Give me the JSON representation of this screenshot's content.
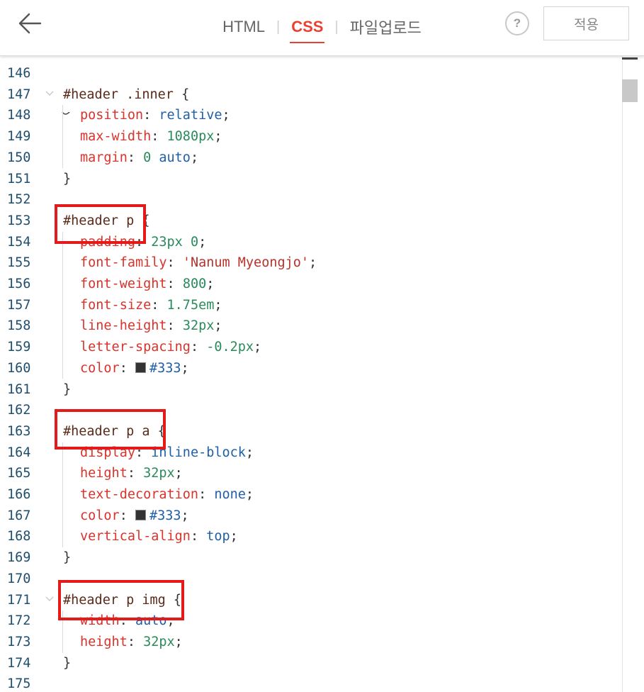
{
  "header": {
    "tabs": [
      {
        "label": "HTML",
        "active": false
      },
      {
        "label": "CSS",
        "active": true
      },
      {
        "label": "파일업로드",
        "active": false
      }
    ],
    "help_label": "?",
    "apply_label": "적용"
  },
  "colors": {
    "accent": "#e9402f",
    "highlight_box": "#e41a1a",
    "swatch_333": "#333333"
  },
  "editor": {
    "lines": [
      {
        "n": "146",
        "tokens": []
      },
      {
        "n": "147",
        "fold": true,
        "tokens": [
          {
            "t": "#header .inner",
            "c": "sel"
          },
          {
            "t": " {",
            "c": "brace"
          }
        ]
      },
      {
        "n": "148",
        "ind": true,
        "tokens": [
          {
            "t": "position",
            "c": "prop"
          },
          {
            "t": ": ",
            "c": "colon"
          },
          {
            "t": "relative",
            "c": "kw"
          },
          {
            "t": ";",
            "c": "semi"
          }
        ]
      },
      {
        "n": "149",
        "ind": true,
        "tokens": [
          {
            "t": "max-width",
            "c": "prop"
          },
          {
            "t": ": ",
            "c": "colon"
          },
          {
            "t": "1080px",
            "c": "val"
          },
          {
            "t": ";",
            "c": "semi"
          }
        ]
      },
      {
        "n": "150",
        "ind": true,
        "tokens": [
          {
            "t": "margin",
            "c": "prop"
          },
          {
            "t": ": ",
            "c": "colon"
          },
          {
            "t": "0",
            "c": "val"
          },
          {
            "t": " auto",
            "c": "kw"
          },
          {
            "t": ";",
            "c": "semi"
          }
        ]
      },
      {
        "n": "151",
        "tokens": [
          {
            "t": "}",
            "c": "brace"
          }
        ]
      },
      {
        "n": "152",
        "tokens": []
      },
      {
        "n": "153",
        "tokens": [
          {
            "t": "#header p",
            "c": "sel"
          },
          {
            "t": " {",
            "c": "brace"
          }
        ]
      },
      {
        "n": "154",
        "ind": true,
        "tokens": [
          {
            "t": "padding",
            "c": "prop"
          },
          {
            "t": ": ",
            "c": "colon"
          },
          {
            "t": "23px 0",
            "c": "val"
          },
          {
            "t": ";",
            "c": "semi"
          }
        ]
      },
      {
        "n": "155",
        "ind": true,
        "tokens": [
          {
            "t": "font-family",
            "c": "prop"
          },
          {
            "t": ": ",
            "c": "colon"
          },
          {
            "t": "'Nanum Myeongjo'",
            "c": "str"
          },
          {
            "t": ";",
            "c": "semi"
          }
        ]
      },
      {
        "n": "156",
        "ind": true,
        "tokens": [
          {
            "t": "font-weight",
            "c": "prop"
          },
          {
            "t": ": ",
            "c": "colon"
          },
          {
            "t": "800",
            "c": "val"
          },
          {
            "t": ";",
            "c": "semi"
          }
        ]
      },
      {
        "n": "157",
        "ind": true,
        "tokens": [
          {
            "t": "font-size",
            "c": "prop"
          },
          {
            "t": ": ",
            "c": "colon"
          },
          {
            "t": "1.75em",
            "c": "val"
          },
          {
            "t": ";",
            "c": "semi"
          }
        ]
      },
      {
        "n": "158",
        "ind": true,
        "tokens": [
          {
            "t": "line-height",
            "c": "prop"
          },
          {
            "t": ": ",
            "c": "colon"
          },
          {
            "t": "32px",
            "c": "val"
          },
          {
            "t": ";",
            "c": "semi"
          }
        ]
      },
      {
        "n": "159",
        "ind": true,
        "tokens": [
          {
            "t": "letter-spacing",
            "c": "prop"
          },
          {
            "t": ": ",
            "c": "colon"
          },
          {
            "t": "-0.2px",
            "c": "val"
          },
          {
            "t": ";",
            "c": "semi"
          }
        ]
      },
      {
        "n": "160",
        "ind": true,
        "tokens": [
          {
            "t": "color",
            "c": "prop"
          },
          {
            "t": ": ",
            "c": "colon"
          },
          {
            "t": "",
            "c": "swatch"
          },
          {
            "t": "#333",
            "c": "kw"
          },
          {
            "t": ";",
            "c": "semi"
          }
        ]
      },
      {
        "n": "161",
        "tokens": [
          {
            "t": "}",
            "c": "brace"
          }
        ]
      },
      {
        "n": "162",
        "tokens": []
      },
      {
        "n": "163",
        "tokens": [
          {
            "t": "#header p a",
            "c": "sel"
          },
          {
            "t": " {",
            "c": "brace"
          }
        ]
      },
      {
        "n": "164",
        "ind": true,
        "tokens": [
          {
            "t": "display",
            "c": "prop"
          },
          {
            "t": ": ",
            "c": "colon"
          },
          {
            "t": "inline-block",
            "c": "kw"
          },
          {
            "t": ";",
            "c": "semi"
          }
        ]
      },
      {
        "n": "165",
        "ind": true,
        "tokens": [
          {
            "t": "height",
            "c": "prop"
          },
          {
            "t": ": ",
            "c": "colon"
          },
          {
            "t": "32px",
            "c": "val"
          },
          {
            "t": ";",
            "c": "semi"
          }
        ]
      },
      {
        "n": "166",
        "ind": true,
        "tokens": [
          {
            "t": "text-decoration",
            "c": "prop"
          },
          {
            "t": ": ",
            "c": "colon"
          },
          {
            "t": "none",
            "c": "kw"
          },
          {
            "t": ";",
            "c": "semi"
          }
        ]
      },
      {
        "n": "167",
        "ind": true,
        "tokens": [
          {
            "t": "color",
            "c": "prop"
          },
          {
            "t": ": ",
            "c": "colon"
          },
          {
            "t": "",
            "c": "swatch"
          },
          {
            "t": "#333",
            "c": "kw"
          },
          {
            "t": ";",
            "c": "semi"
          }
        ]
      },
      {
        "n": "168",
        "ind": true,
        "tokens": [
          {
            "t": "vertical-align",
            "c": "prop"
          },
          {
            "t": ": ",
            "c": "colon"
          },
          {
            "t": "top",
            "c": "kw"
          },
          {
            "t": ";",
            "c": "semi"
          }
        ]
      },
      {
        "n": "169",
        "tokens": [
          {
            "t": "}",
            "c": "brace"
          }
        ]
      },
      {
        "n": "170",
        "tokens": []
      },
      {
        "n": "171",
        "fold": true,
        "tokens": [
          {
            "t": "#header p img",
            "c": "sel"
          },
          {
            "t": " {",
            "c": "brace"
          }
        ]
      },
      {
        "n": "172",
        "ind": true,
        "tokens": [
          {
            "t": "width",
            "c": "prop"
          },
          {
            "t": ": ",
            "c": "colon"
          },
          {
            "t": "auto",
            "c": "kw"
          },
          {
            "t": ";",
            "c": "semi"
          }
        ]
      },
      {
        "n": "173",
        "ind": true,
        "tokens": [
          {
            "t": "height",
            "c": "prop"
          },
          {
            "t": ": ",
            "c": "colon"
          },
          {
            "t": "32px",
            "c": "val"
          },
          {
            "t": ";",
            "c": "semi"
          }
        ]
      },
      {
        "n": "174",
        "tokens": [
          {
            "t": "}",
            "c": "brace"
          }
        ]
      },
      {
        "n": "175",
        "tokens": []
      }
    ]
  }
}
